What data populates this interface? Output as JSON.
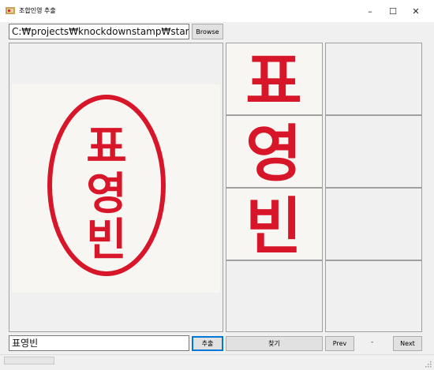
{
  "window": {
    "title": "조합인영 추출",
    "minimize_glyph": "–",
    "maximize_glyph": "☐",
    "close_glyph": "✕"
  },
  "toolbar": {
    "path_value": "C:₩projects₩knockdownstamp₩stamp₩",
    "browse_label": "Browse"
  },
  "stamp": {
    "characters": [
      "표",
      "영",
      "빈"
    ],
    "ink_color": "#d8162a"
  },
  "bottom": {
    "name_value": "표영빈",
    "extract_label": "추출",
    "find_label": "찾기",
    "prev_label": "Prev",
    "page_indicator": "-",
    "next_label": "Next"
  },
  "icons": {
    "app": "stamp-app-icon",
    "grip": "resize-grip-icon"
  }
}
